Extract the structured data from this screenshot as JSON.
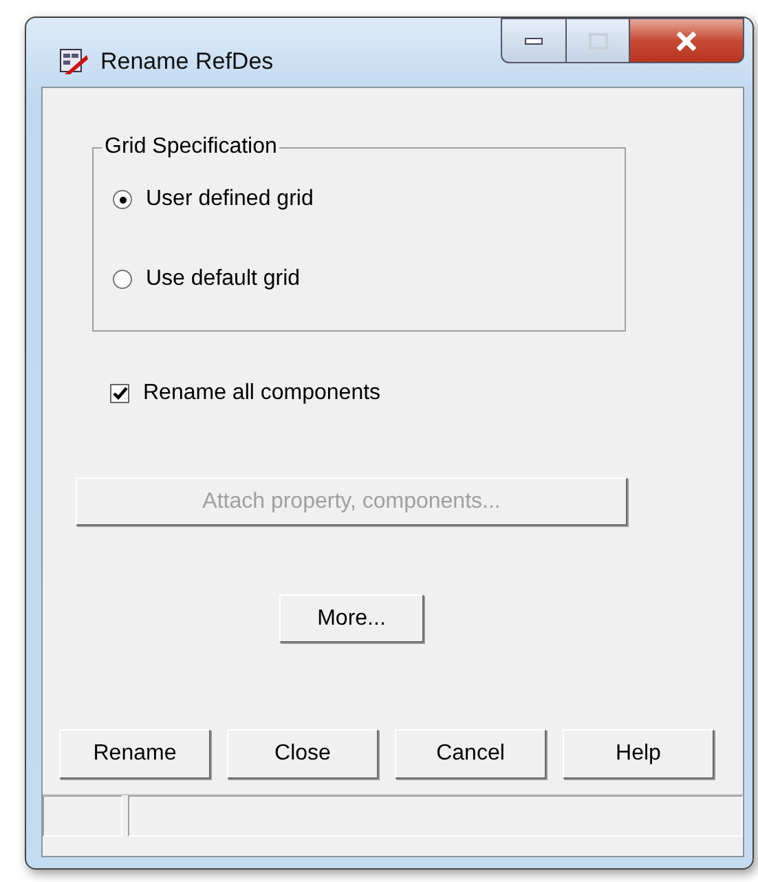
{
  "window": {
    "title": "Rename RefDes"
  },
  "grid_specification": {
    "title": "Grid Specification",
    "options": [
      {
        "label": "User defined grid",
        "selected": true
      },
      {
        "label": "Use default grid",
        "selected": false
      }
    ]
  },
  "rename_all": {
    "label": "Rename all components",
    "checked": true
  },
  "attach_button": {
    "label": "Attach property, components...",
    "disabled": true
  },
  "more_button": {
    "label": "More...",
    "disabled": false
  },
  "buttons": [
    {
      "label": "Rename"
    },
    {
      "label": "Close"
    },
    {
      "label": "Cancel"
    },
    {
      "label": "Help"
    }
  ]
}
